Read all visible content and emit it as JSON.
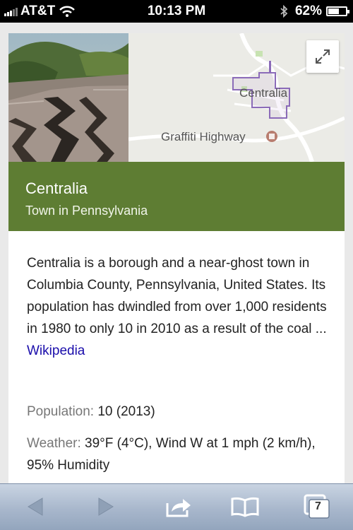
{
  "status_bar": {
    "carrier": "AT&T",
    "time": "10:13 PM",
    "battery_percent": "62%",
    "battery_level": 0.62
  },
  "card": {
    "map_labels": {
      "town": "Centralia",
      "poi": "Graffiti Highway"
    },
    "title": "Centralia",
    "subtitle": "Town in Pennsylvania",
    "description": "Centralia is a borough and a near-ghost town in Columbia County, Pennsylvania, United States. Its population has dwindled from over 1,000 residents in 1980 to only 10 in 2010 as a result of the coal ...",
    "source_link": "Wikipedia",
    "facts": [
      {
        "label": "Population:",
        "value": " 10 (2013)"
      },
      {
        "label": "Weather:",
        "value": " 39°F (4°C), Wind W at 1 mph (2 km/h), 95% Humidity"
      }
    ],
    "header_color": "#5e7d33",
    "link_color": "#1a0dab"
  },
  "toolbar": {
    "icons": [
      "back-arrow-icon",
      "forward-arrow-icon",
      "share-icon",
      "bookmarks-icon",
      "tabs-icon"
    ],
    "tab_count": "7"
  }
}
